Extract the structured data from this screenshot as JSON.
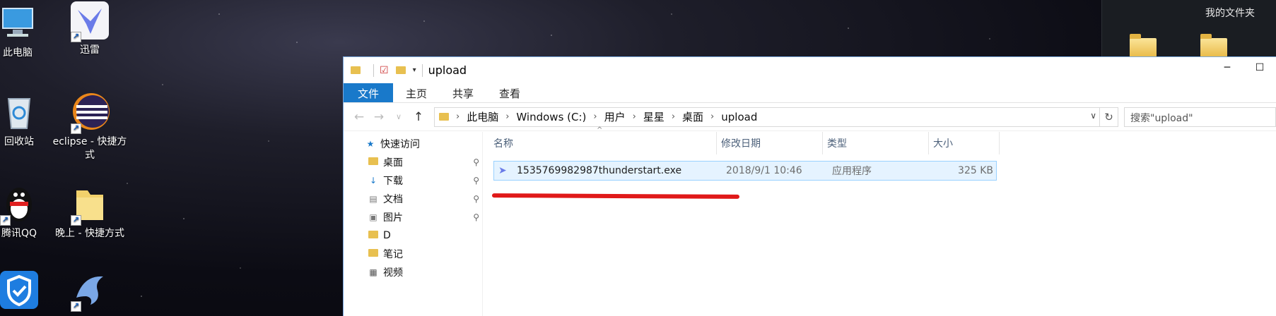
{
  "desktop": {
    "icons": [
      {
        "label": "此电脑",
        "icon": "computer-icon",
        "shortcut": false
      },
      {
        "label": "迅雷",
        "icon": "xunlei-bird-icon",
        "shortcut": true
      },
      {
        "label": "回收站",
        "icon": "recycle-bin-icon",
        "shortcut": false
      },
      {
        "label": "eclipse - 快捷方式",
        "icon": "eclipse-icon",
        "shortcut": true
      },
      {
        "label": "腾讯QQ",
        "icon": "qq-penguin-icon",
        "shortcut": true
      },
      {
        "label": "晚上 - 快捷方式",
        "icon": "folder-icon",
        "shortcut": true
      },
      {
        "label": "",
        "icon": "shield-icon",
        "shortcut": false
      },
      {
        "label": "",
        "icon": "dolphin-icon",
        "shortcut": true
      }
    ],
    "right_folder_label": "我的文件夹"
  },
  "explorer": {
    "title": "upload",
    "window_controls": {
      "minimize": "─",
      "maximize": "☐"
    },
    "ribbon_tabs": [
      "文件",
      "主页",
      "共享",
      "查看"
    ],
    "breadcrumb": [
      "此电脑",
      "Windows (C:)",
      "用户",
      "星星",
      "桌面",
      "upload"
    ],
    "search_placeholder": "搜索\"upload\"",
    "sidebar": {
      "quick_access": "快速访问",
      "items": [
        {
          "label": "桌面",
          "pinned": true
        },
        {
          "label": "下载",
          "pinned": true
        },
        {
          "label": "文档",
          "pinned": true
        },
        {
          "label": "图片",
          "pinned": true
        },
        {
          "label": "D",
          "pinned": false
        },
        {
          "label": "笔记",
          "pinned": false
        },
        {
          "label": "视频",
          "pinned": false
        }
      ]
    },
    "columns": [
      "名称",
      "修改日期",
      "类型",
      "大小"
    ],
    "files": [
      {
        "name": "1535769982987thunderstart.exe",
        "modified": "2018/9/1 10:46",
        "type": "应用程序",
        "size": "325 KB"
      }
    ]
  },
  "colors": {
    "accent": "#1979ca",
    "selection": "#e5f3ff",
    "annotation": "#e01919"
  }
}
